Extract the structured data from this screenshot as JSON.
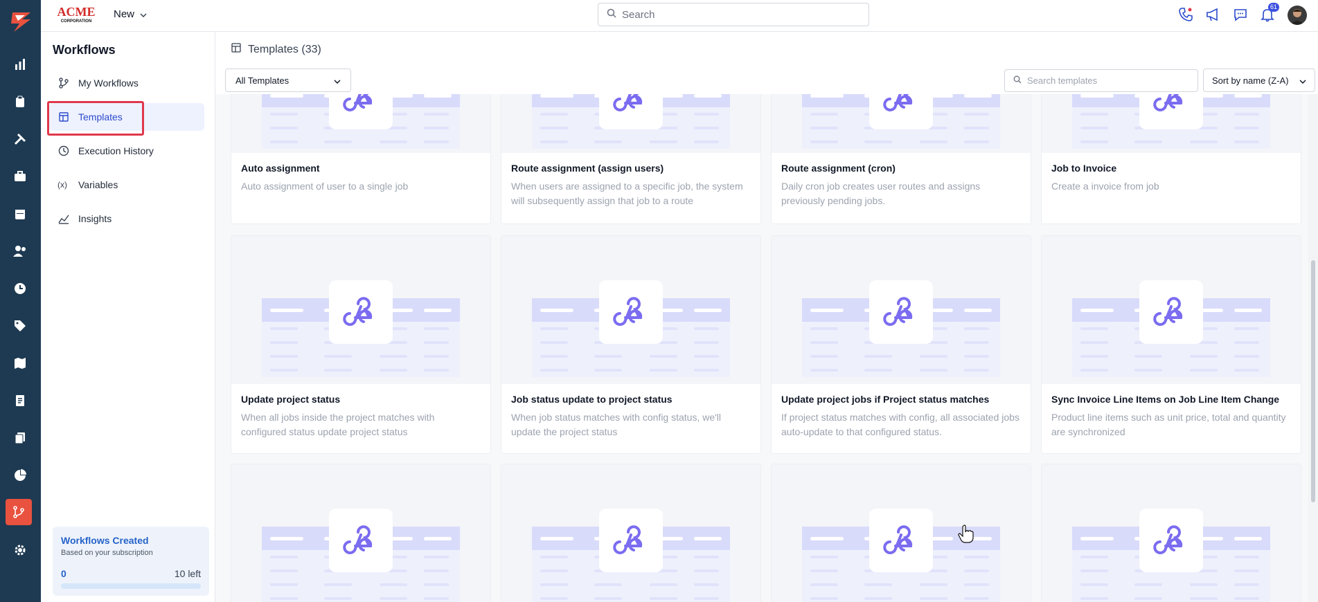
{
  "brand": {
    "text_top": "ACME",
    "text_bottom": "CORPORATION"
  },
  "topbar": {
    "new_label": "New",
    "search_placeholder": "Search",
    "notification_count": "61"
  },
  "rail": {
    "icons": [
      "logo-icon",
      "chart-icon",
      "clipboard-icon",
      "tools-icon",
      "briefcase-icon",
      "calendar-icon",
      "users-icon",
      "clock-icon",
      "tag-icon",
      "map-icon",
      "receipt-icon",
      "documents-icon",
      "pie-chart-icon",
      "workflow-icon",
      "gear-icon"
    ]
  },
  "sidebar": {
    "title": "Workflows",
    "items": [
      {
        "label": "My Workflows",
        "icon": "branch-icon"
      },
      {
        "label": "Templates",
        "icon": "template-icon"
      },
      {
        "label": "Execution History",
        "icon": "history-icon"
      },
      {
        "label": "Variables",
        "icon": "variables-icon"
      },
      {
        "label": "Insights",
        "icon": "insights-icon"
      }
    ],
    "card": {
      "title": "Workflows Created",
      "subtitle": "Based on your subscription",
      "count": "0",
      "left": "10 left",
      "used_fraction": 0
    }
  },
  "main": {
    "title": "Templates (33)",
    "filter": "All Templates",
    "search_placeholder": "Search templates",
    "sort": "Sort by name (Z-A)",
    "templates": [
      {
        "title": "Auto assignment",
        "desc": "Auto assignment of user to a single job"
      },
      {
        "title": "Route assignment (assign users)",
        "desc": "When users are assigned to a specific job, the system will subsequently assign that job to a route"
      },
      {
        "title": "Route assignment (cron)",
        "desc": "Daily cron job creates user routes and assigns previously pending jobs."
      },
      {
        "title": "Job to Invoice",
        "desc": "Create a invoice from job"
      },
      {
        "title": "Update project status",
        "desc": "When all jobs inside the project matches with configured status update project status"
      },
      {
        "title": "Job status update to project status",
        "desc": "When job status matches with config status, we'll update the project status"
      },
      {
        "title": "Update project jobs if Project status matches",
        "desc": "If project status matches with config, all associated jobs auto-update to that configured status."
      },
      {
        "title": "Sync Invoice Line Items on Job Line Item Change",
        "desc": "Product line items such as unit price, total and quantity are synchronized"
      }
    ]
  },
  "colors": {
    "rail_bg": "#1e3a52",
    "accent": "#e8523f",
    "primary": "#2b4acb",
    "highlight": "#e0384b",
    "icon_purple": "#7b6cf0"
  }
}
